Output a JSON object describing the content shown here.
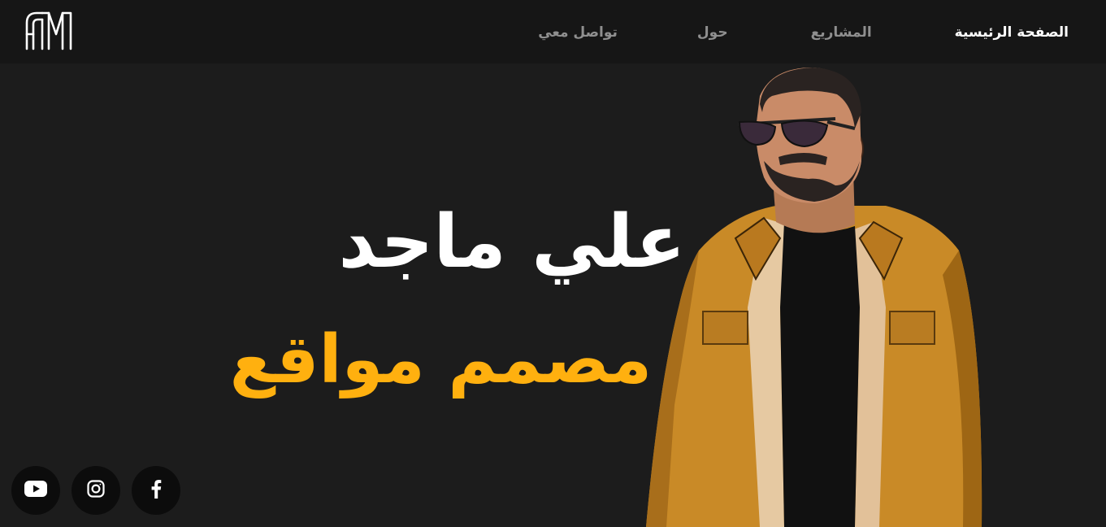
{
  "header": {
    "logo": {
      "icon": "am-monogram-logo",
      "color": "#ffffff"
    },
    "nav": [
      {
        "label": "الصفحة الرئيسية",
        "active": true
      },
      {
        "label": "المشاريع",
        "active": false
      },
      {
        "label": "حول",
        "active": false
      },
      {
        "label": "تواصل معي",
        "active": false
      }
    ]
  },
  "hero": {
    "name": "علي ماجد",
    "role": "مصمم مواقع",
    "role_color": "#ffb00f",
    "image": "person-illustration-yellow-jacket-sunglasses"
  },
  "social": [
    {
      "icon": "youtube-icon"
    },
    {
      "icon": "instagram-icon"
    },
    {
      "icon": "facebook-icon"
    }
  ],
  "colors": {
    "background": "#1c1c1c",
    "header": "#161616",
    "accent": "#ffb00f",
    "nav_inactive": "#8f8f8f",
    "nav_active": "#ffffff"
  }
}
